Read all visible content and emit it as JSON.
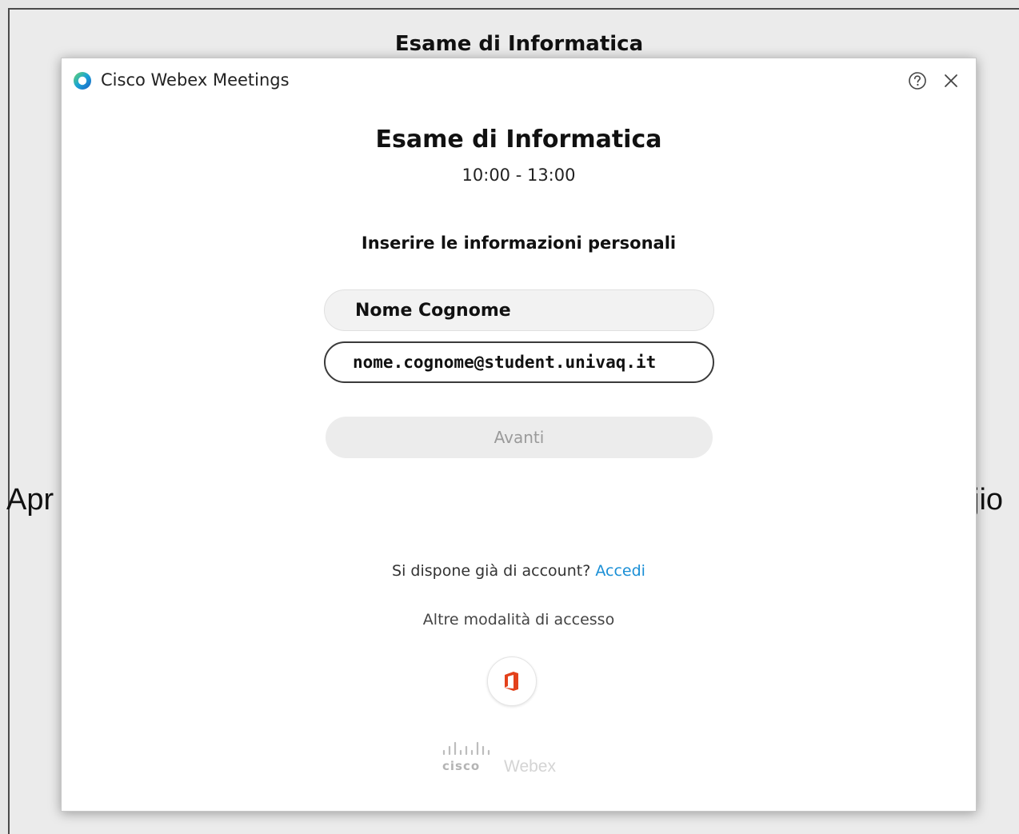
{
  "background": {
    "title": "Esame di Informatica",
    "left_text": "Apr",
    "right_text": "jio"
  },
  "window": {
    "app_title": "Cisco Webex Meetings",
    "icons": {
      "logo": "webex-logo-icon",
      "help": "help-icon",
      "close": "close-icon"
    }
  },
  "meeting": {
    "title": "Esame di Informatica",
    "time": "10:00 - 13:00"
  },
  "form": {
    "heading": "Inserire le informazioni personali",
    "name_value": "Nome Cognome",
    "email_value": "nome.cognome@student.univaq.it",
    "next_label": "Avanti"
  },
  "account": {
    "prompt": "Si dispone già di account?",
    "signin_link": "Accedi",
    "alt_access": "Altre modalità di accesso"
  },
  "branding": {
    "cisco": "cisco",
    "webex": "Webex"
  },
  "colors": {
    "link": "#1a8fd6",
    "office_red": "#e3411b",
    "disabled_button": "#ececec"
  }
}
